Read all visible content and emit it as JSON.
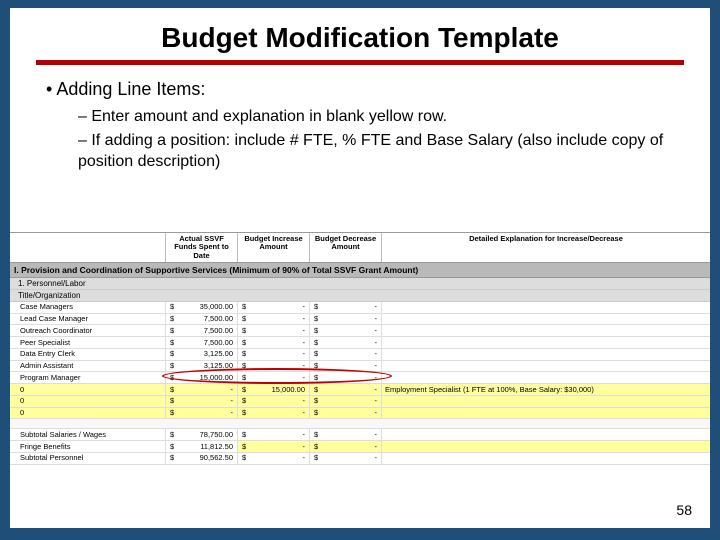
{
  "title": "Budget Modification Template",
  "bullets": {
    "l1": "Adding Line Items:",
    "l2a": "Enter amount and explanation in blank yellow row.",
    "l2b": "If adding a position:  include # FTE, % FTE and Base Salary (also include copy of position description)"
  },
  "headers": {
    "c0": "",
    "c1": "Actual SSVF Funds Spent to Date",
    "c2": "Budget Increase Amount",
    "c3": "Budget Decrease Amount",
    "c4": "Detailed Explanation for Increase/Decrease"
  },
  "section": "I. Provision and Coordination of Supportive Services (Minimum of 90% of Total SSVF Grant Amount)",
  "group1": "1. Personnel/Labor",
  "group1sub": "Title/Organization",
  "rows": [
    {
      "label": "Case Managers",
      "a": "35,000.00",
      "b": "-",
      "c": "-",
      "e": ""
    },
    {
      "label": "Lead Case Manager",
      "a": "7,500.00",
      "b": "-",
      "c": "-",
      "e": ""
    },
    {
      "label": "Outreach Coordinator",
      "a": "7,500.00",
      "b": "-",
      "c": "-",
      "e": ""
    },
    {
      "label": "Peer Specialist",
      "a": "7,500.00",
      "b": "-",
      "c": "-",
      "e": ""
    },
    {
      "label": "Data Entry Clerk",
      "a": "3,125.00",
      "b": "-",
      "c": "-",
      "e": ""
    },
    {
      "label": "Admin Assistant",
      "a": "3,125.00",
      "b": "-",
      "c": "-",
      "e": ""
    },
    {
      "label": "Program Manager",
      "a": "15,000.00",
      "b": "-",
      "c": "-",
      "e": ""
    }
  ],
  "yellowRows": [
    {
      "label": "0",
      "a": "-",
      "b": "15,000.00",
      "c": "-",
      "e": "Employment Specialist (1 FTE at 100%, Base Salary: $30,000)"
    },
    {
      "label": "0",
      "a": "-",
      "b": "-",
      "c": "-",
      "e": ""
    },
    {
      "label": "0",
      "a": "-",
      "b": "-",
      "c": "-",
      "e": ""
    }
  ],
  "subtotal": {
    "label": "Subtotal Salaries / Wages",
    "a": "78,750.00",
    "b": "-",
    "c": "-"
  },
  "fringe": {
    "label": "Fringe Benefits",
    "a": "11,812.50",
    "b": "-",
    "c": "-"
  },
  "subtotalP": {
    "label": "Subtotal Personnel",
    "a": "90,562.50",
    "b": "-",
    "c": "-"
  },
  "page": "58"
}
